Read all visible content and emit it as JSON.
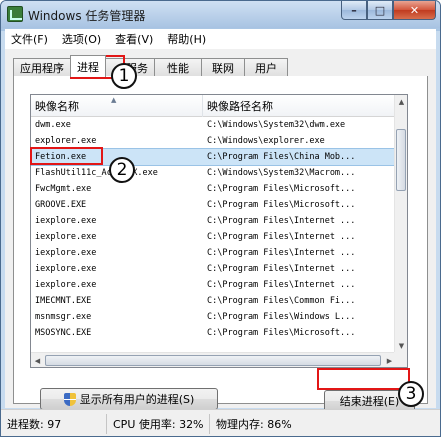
{
  "window": {
    "title": "Windows 任务管理器",
    "minimize_glyph": "–",
    "maximize_glyph": "□",
    "close_glyph": "✕"
  },
  "menu": [
    {
      "label": "文件(F)"
    },
    {
      "label": "选项(O)"
    },
    {
      "label": "查看(V)"
    },
    {
      "label": "帮助(H)"
    }
  ],
  "tabs": [
    {
      "label": "应用程序",
      "active": false
    },
    {
      "label": "进程",
      "active": true
    },
    {
      "label": "服务",
      "active": false
    },
    {
      "label": "性能",
      "active": false
    },
    {
      "label": "联网",
      "active": false
    },
    {
      "label": "用户",
      "active": false
    }
  ],
  "table": {
    "columns": [
      "映像名称",
      "映像路径名称"
    ],
    "sort_arrow": "▲",
    "rows": [
      {
        "name": "dwm.exe",
        "path": "C:\\Windows\\System32\\dwm.exe",
        "selected": false
      },
      {
        "name": "explorer.exe",
        "path": "C:\\Windows\\explorer.exe",
        "selected": false
      },
      {
        "name": "Fetion.exe",
        "path": "C:\\Program Files\\China Mob...",
        "selected": true
      },
      {
        "name": "FlashUtil11c_ActiveX.exe",
        "path": "C:\\Windows\\System32\\Macrom...",
        "selected": false
      },
      {
        "name": "FwcMgmt.exe",
        "path": "C:\\Program Files\\Microsoft...",
        "selected": false
      },
      {
        "name": "GROOVE.EXE",
        "path": "C:\\Program Files\\Microsoft...",
        "selected": false
      },
      {
        "name": "iexplore.exe",
        "path": "C:\\Program Files\\Internet ...",
        "selected": false
      },
      {
        "name": "iexplore.exe",
        "path": "C:\\Program Files\\Internet ...",
        "selected": false
      },
      {
        "name": "iexplore.exe",
        "path": "C:\\Program Files\\Internet ...",
        "selected": false
      },
      {
        "name": "iexplore.exe",
        "path": "C:\\Program Files\\Internet ...",
        "selected": false
      },
      {
        "name": "iexplore.exe",
        "path": "C:\\Program Files\\Internet ...",
        "selected": false
      },
      {
        "name": "IMECMNT.EXE",
        "path": "C:\\Program Files\\Common Fi...",
        "selected": false
      },
      {
        "name": "msnmsgr.exe",
        "path": "C:\\Program Files\\Windows L...",
        "selected": false
      },
      {
        "name": "MSOSYNC.EXE",
        "path": "C:\\Program Files\\Microsoft...",
        "selected": false
      }
    ]
  },
  "buttons": {
    "show_all": "显示所有用户的进程(S)",
    "end_process": "结束进程(E)"
  },
  "status": {
    "processes": "进程数: 97",
    "cpu": "CPU 使用率: 32%",
    "memory": "物理内存: 86%"
  },
  "annotations": [
    "1",
    "2",
    "3"
  ],
  "colors": {
    "annotation_red": "#e21616",
    "selection": "#cce4f7"
  },
  "icons": {
    "app": "task-manager-icon",
    "shield": "uac-shield-icon"
  }
}
